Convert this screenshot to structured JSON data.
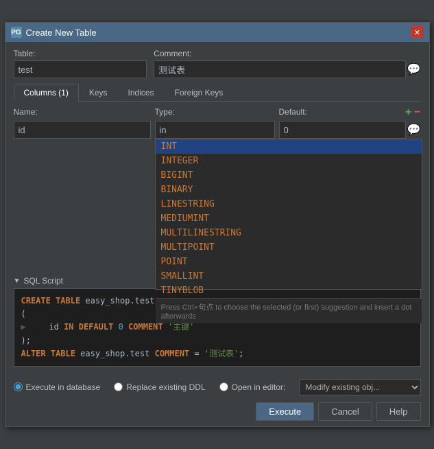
{
  "title": "Create New Table",
  "titleIcon": "PG",
  "tableLabel": "Table:",
  "tableValue": "test",
  "commentLabel": "Comment:",
  "commentValue": "测试表",
  "tabs": [
    {
      "label": "Columns (1)",
      "active": true
    },
    {
      "label": "Keys",
      "active": false
    },
    {
      "label": "Indices",
      "active": false
    },
    {
      "label": "Foreign Keys",
      "active": false
    }
  ],
  "columns": {
    "nameHeader": "Name:",
    "typeHeader": "Type:",
    "defaultHeader": "Default:",
    "row": {
      "name": "id",
      "type": "in",
      "default": "0"
    }
  },
  "autocomplete": {
    "items": [
      "INT",
      "INTEGER",
      "BIGINT",
      "BINARY",
      "LINESTRING",
      "MEDIUMINT",
      "MULTILINESTRING",
      "MULTIPOINT",
      "POINT",
      "SMALLINT",
      "TINYBLOB"
    ],
    "hint": "Press Ctrl+句点 to choose the selected (or first) suggestion and insert a dot afterwards"
  },
  "sqlScript": {
    "label": "SQL Script",
    "lines": [
      {
        "type": "kw",
        "text": "CREATE TABLE easy_shop.test"
      },
      {
        "type": "plain",
        "text": "("
      },
      {
        "type": "mixed",
        "parts": [
          {
            "t": "plain",
            "v": "    id "
          },
          {
            "t": "kw",
            "v": "IN DEFAULT"
          },
          {
            "t": "plain",
            "v": " 0 "
          },
          {
            "t": "kw",
            "v": "COMMENT"
          },
          {
            "t": "str",
            "v": "'主键'"
          }
        ]
      },
      {
        "type": "plain",
        "text": ");"
      },
      {
        "type": "mixed",
        "parts": [
          {
            "t": "kw",
            "v": "ALTER TABLE"
          },
          {
            "t": "plain",
            "v": " easy_shop.test "
          },
          {
            "t": "kw",
            "v": "COMMENT"
          },
          {
            "t": "plain",
            "v": " = "
          },
          {
            "t": "str",
            "v": "'测试表'"
          },
          {
            "t": "plain",
            "v": ";"
          }
        ]
      }
    ]
  },
  "options": {
    "executeInDatabase": "Execute in database",
    "replaceExistingDDL": "Replace existing DDL",
    "openInEditor": "Open in editor:",
    "modifyPlaceholder": "Modify existing obj..."
  },
  "buttons": {
    "execute": "Execute",
    "cancel": "Cancel",
    "help": "Help"
  }
}
